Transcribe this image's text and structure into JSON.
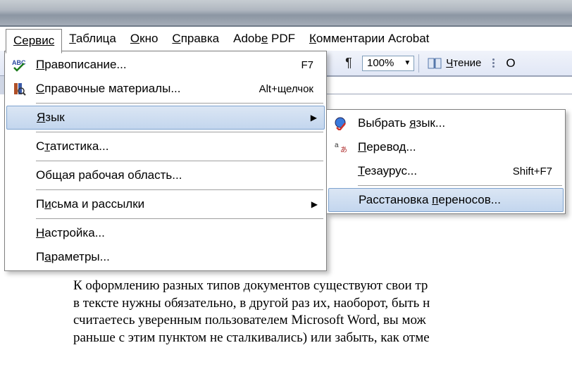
{
  "menubar": {
    "service": "Сервис",
    "table": "Таблица",
    "window": "Окно",
    "help": "Справка",
    "adobe": "Adobe PDF",
    "acrobat": "Комментарии Acrobat"
  },
  "toolbar": {
    "zoom": "100%",
    "reading": "Чтение",
    "extra": "О"
  },
  "menu": {
    "spelling": "Правописание...",
    "spelling_key": "F7",
    "research": "Справочные материалы...",
    "research_key": "Alt+щелчок",
    "language": "Язык",
    "statistics": "Статистика...",
    "sharedws": "Общая рабочая область...",
    "mailings": "Письма и рассылки",
    "customize": "Настройка...",
    "options": "Параметры..."
  },
  "submenu": {
    "setlang": "Выбрать язык...",
    "translate": "Перевод...",
    "thesaurus": "Тезаурус...",
    "thesaurus_key": "Shift+F7",
    "hyphenation": "Расстановка переносов..."
  },
  "document": {
    "line1": "К оформлению разных типов документов существуют свои тр",
    "line2": "в тексте нужны обязательно, в другой раз их, наоборот, быть н",
    "line3": "считаетесь уверенным пользователем Microsoft Word, вы мож",
    "line4": "раньше с этим пунктом не сталкивались) или забыть, как отме"
  }
}
